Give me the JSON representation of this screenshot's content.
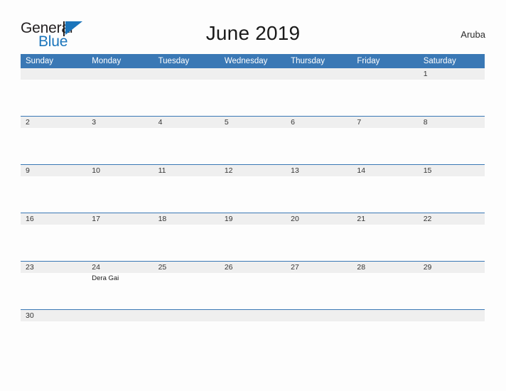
{
  "brand": {
    "name_part1": "General",
    "name_part2": "Blue",
    "colors": {
      "dark": "#231f20",
      "blue": "#1b75bb"
    }
  },
  "header": {
    "title": "June 2019",
    "region": "Aruba"
  },
  "theme": {
    "header_blue": "#3a78b5",
    "row_gray": "#efefef",
    "page_background": "#fdfdfd",
    "text": "#333333"
  },
  "calendar": {
    "month": "June",
    "year": "2019",
    "weekdays": [
      "Sunday",
      "Monday",
      "Tuesday",
      "Wednesday",
      "Thursday",
      "Friday",
      "Saturday"
    ],
    "weeks": [
      {
        "days": [
          {
            "num": "",
            "events": []
          },
          {
            "num": "",
            "events": []
          },
          {
            "num": "",
            "events": []
          },
          {
            "num": "",
            "events": []
          },
          {
            "num": "",
            "events": []
          },
          {
            "num": "",
            "events": []
          },
          {
            "num": "1",
            "events": []
          }
        ]
      },
      {
        "days": [
          {
            "num": "2",
            "events": []
          },
          {
            "num": "3",
            "events": []
          },
          {
            "num": "4",
            "events": []
          },
          {
            "num": "5",
            "events": []
          },
          {
            "num": "6",
            "events": []
          },
          {
            "num": "7",
            "events": []
          },
          {
            "num": "8",
            "events": []
          }
        ]
      },
      {
        "days": [
          {
            "num": "9",
            "events": []
          },
          {
            "num": "10",
            "events": []
          },
          {
            "num": "11",
            "events": []
          },
          {
            "num": "12",
            "events": []
          },
          {
            "num": "13",
            "events": []
          },
          {
            "num": "14",
            "events": []
          },
          {
            "num": "15",
            "events": []
          }
        ]
      },
      {
        "days": [
          {
            "num": "16",
            "events": []
          },
          {
            "num": "17",
            "events": []
          },
          {
            "num": "18",
            "events": []
          },
          {
            "num": "19",
            "events": []
          },
          {
            "num": "20",
            "events": []
          },
          {
            "num": "21",
            "events": []
          },
          {
            "num": "22",
            "events": []
          }
        ]
      },
      {
        "days": [
          {
            "num": "23",
            "events": []
          },
          {
            "num": "24",
            "events": [
              "Dera Gai"
            ]
          },
          {
            "num": "25",
            "events": []
          },
          {
            "num": "26",
            "events": []
          },
          {
            "num": "27",
            "events": []
          },
          {
            "num": "28",
            "events": []
          },
          {
            "num": "29",
            "events": []
          }
        ]
      },
      {
        "short": true,
        "days": [
          {
            "num": "30",
            "events": []
          },
          {
            "num": "",
            "events": []
          },
          {
            "num": "",
            "events": []
          },
          {
            "num": "",
            "events": []
          },
          {
            "num": "",
            "events": []
          },
          {
            "num": "",
            "events": []
          },
          {
            "num": "",
            "events": []
          }
        ]
      }
    ]
  }
}
